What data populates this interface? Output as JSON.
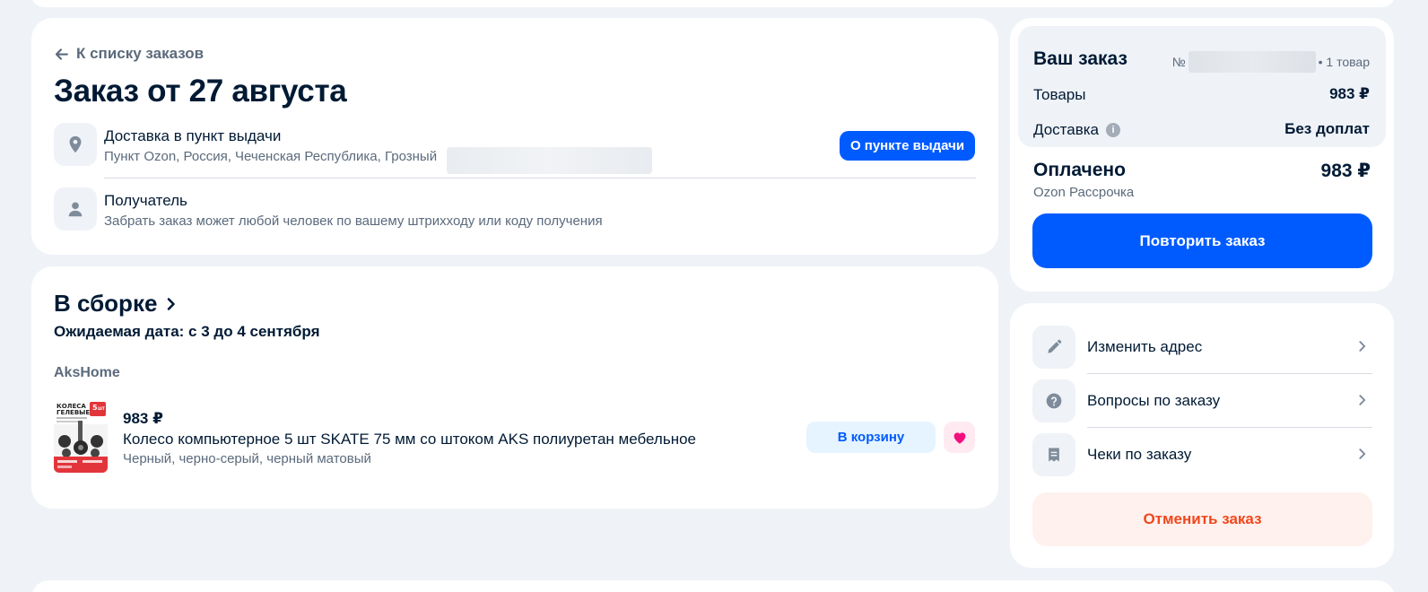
{
  "order": {
    "back_link": "К списку заказов",
    "title": "Заказ от 27 августа",
    "delivery": {
      "title": "Доставка в пункт выдачи",
      "address": "Пункт Ozon, Россия, Чеченская Республика, Грозный",
      "button": "О пункте выдачи"
    },
    "recipient": {
      "title": "Получатель",
      "subtitle": "Забрать заказ может любой человек по вашему штрихходу или коду получения"
    }
  },
  "assembly": {
    "status": "В сборке",
    "expected_date": "Ожидаемая дата: с 3 до 4 сентября",
    "seller": "AksHome",
    "product": {
      "price": "983 ₽",
      "name": "Колесо компьютерное 5 шт SKATE 75 мм со штоком AKS полиуретан мебельное",
      "variant": "Черный, черно-серый, черный матовый",
      "image_text": {
        "line1": "КОЛЕСА",
        "line2": "ГЕЛЕВЫЕ",
        "badge_top": "5",
        "badge_bottom": "ШТ"
      },
      "cart_button": "В корзину"
    }
  },
  "summary": {
    "title": "Ваш заказ",
    "number_prefix": "№",
    "items_count": "• 1 товар",
    "goods_label": "Товары",
    "goods_value": "983 ₽",
    "delivery_label": "Доставка",
    "delivery_value": "Без доплат",
    "paid_label": "Оплачено",
    "paid_value": "983 ₽",
    "payment_method": "Ozon Рассрочка",
    "repeat_button": "Повторить заказ"
  },
  "actions": {
    "items": [
      {
        "label": "Изменить адрес",
        "icon": "pencil-icon"
      },
      {
        "label": "Вопросы по заказу",
        "icon": "question-icon"
      },
      {
        "label": "Чеки по заказу",
        "icon": "receipt-icon"
      }
    ],
    "cancel_button": "Отменить заказ"
  },
  "colors": {
    "accent": "#005bff",
    "danger": "#f1471d",
    "favorite": "#f1117e",
    "background": "#eff2f7"
  }
}
